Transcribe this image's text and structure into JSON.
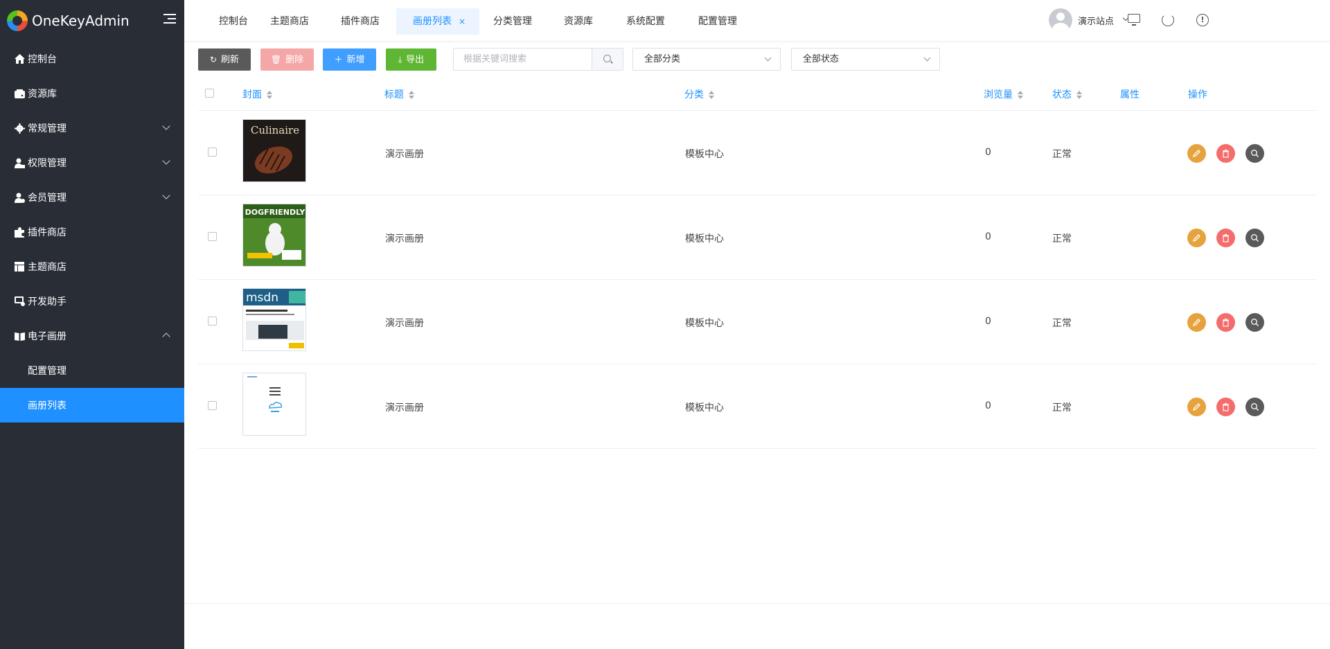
{
  "app": {
    "name": "OneKeyAdmin"
  },
  "sidebar": {
    "items": [
      {
        "label": "控制台",
        "icon": "home-icon"
      },
      {
        "label": "资源库",
        "icon": "drive-icon"
      },
      {
        "label": "常规管理",
        "icon": "gear-icon",
        "expandable": true
      },
      {
        "label": "权限管理",
        "icon": "user-lock-icon",
        "expandable": true
      },
      {
        "label": "会员管理",
        "icon": "member-icon",
        "expandable": true
      },
      {
        "label": "插件商店",
        "icon": "puzzle-icon"
      },
      {
        "label": "主题商店",
        "icon": "layout-icon"
      },
      {
        "label": "开发助手",
        "icon": "code-icon"
      },
      {
        "label": "电子画册",
        "icon": "book-icon",
        "expanded": true
      }
    ],
    "sub_items": [
      {
        "label": "配置管理"
      },
      {
        "label": "画册列表",
        "active": true
      }
    ]
  },
  "tabs": [
    {
      "label": "控制台"
    },
    {
      "label": "主题商店"
    },
    {
      "label": "插件商店"
    },
    {
      "label": "画册列表",
      "active": true,
      "close": "×"
    },
    {
      "label": "分类管理"
    },
    {
      "label": "资源库"
    },
    {
      "label": "系统配置"
    },
    {
      "label": "配置管理"
    }
  ],
  "header": {
    "site_name": "演示站点"
  },
  "toolbar": {
    "refresh_label": "刷新",
    "delete_label": "删除",
    "add_label": "新增",
    "export_label": "导出",
    "search_placeholder": "根据关键词搜索",
    "category_select": "全部分类",
    "status_select": "全部状态"
  },
  "table": {
    "headers": {
      "cover": "封面",
      "title": "标题",
      "category": "分类",
      "views": "浏览量",
      "status": "状态",
      "attributes": "属性",
      "actions": "操作"
    },
    "rows": [
      {
        "cover": "Culinaire",
        "title": "演示画册",
        "category": "模板中心",
        "views": "0",
        "status": "正常"
      },
      {
        "cover": "DOGFRIENDLY",
        "title": "演示画册",
        "category": "模板中心",
        "views": "0",
        "status": "正常"
      },
      {
        "cover": "msdn",
        "title": "演示画册",
        "category": "模板中心",
        "views": "0",
        "status": "正常"
      },
      {
        "cover": "",
        "title": "演示画册",
        "category": "模板中心",
        "views": "0",
        "status": "正常"
      }
    ]
  },
  "colors": {
    "sidebar_bg": "#282d36",
    "accent": "#1e90ff",
    "edit": "#e6a23c",
    "delete": "#f56c6c",
    "view": "#5a5a5a",
    "export": "#5fb632"
  }
}
